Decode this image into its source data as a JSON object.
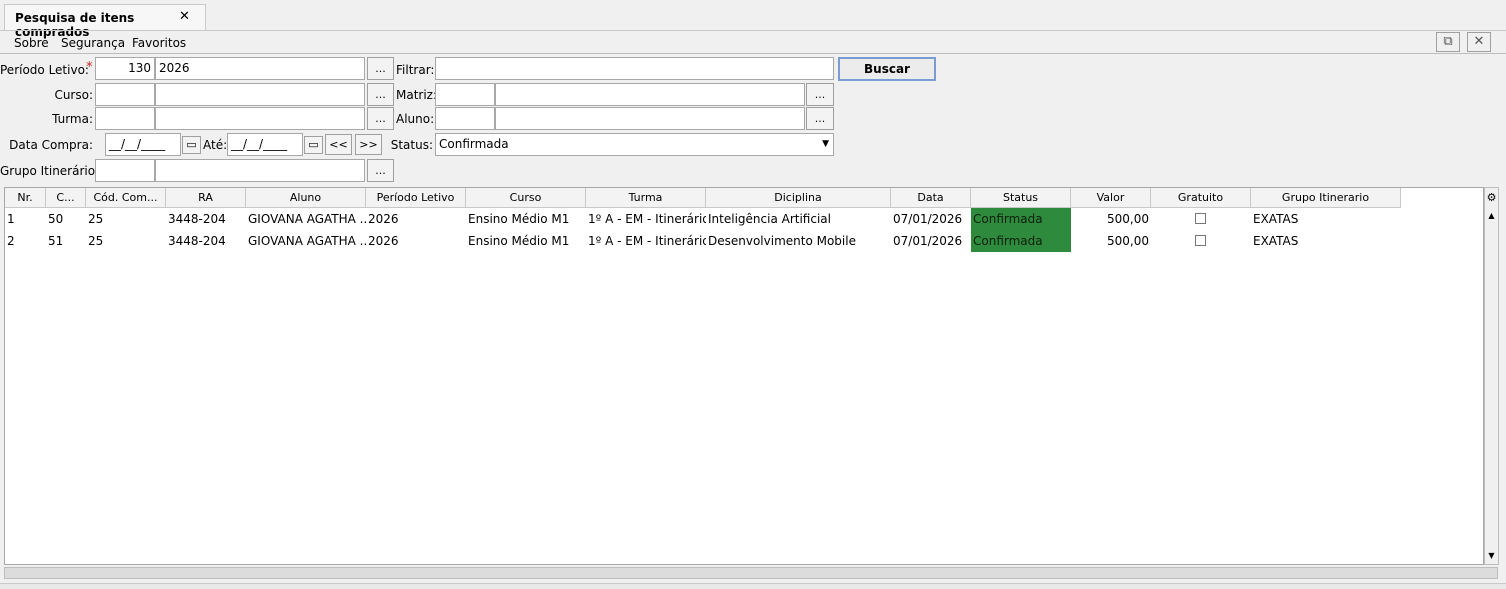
{
  "tab": {
    "title": "Pesquisa de itens comprados",
    "close": "✕"
  },
  "menu": {
    "sobre": "Sobre",
    "seguranca": "Segurança",
    "favoritos": "Favoritos"
  },
  "window_buttons": {
    "popout": "⧉",
    "close": "✕"
  },
  "form": {
    "periodo_label": "Período Letivo:",
    "periodo_code": "130",
    "periodo_desc": "2026",
    "filtrar_label": "Filtrar:",
    "filtrar_value": "",
    "buscar_label": "Buscar",
    "curso_label": "Curso:",
    "matriz_label": "Matriz:",
    "turma_label": "Turma:",
    "aluno_label": "Aluno:",
    "data_compra_label": "Data Compra:",
    "data_compra_value": "__/__/____",
    "ate_label": "Até:",
    "ate_value": "__/__/____",
    "prev_label": "<<",
    "next_label": ">>",
    "status_label": "Status:",
    "status_value": "Confirmada",
    "grupo_label": "Grupo Itinerário:",
    "ellipsis": "..."
  },
  "grid": {
    "columns": [
      "Nr.",
      "C...",
      "Cód. Com...",
      "RA",
      "Aluno",
      "Período Letivo",
      "Curso",
      "Turma",
      "Diciplina",
      "Data",
      "Status",
      "Valor",
      "Gratuito",
      "Grupo Itinerario"
    ],
    "rows": [
      {
        "nr": "1",
        "c": "50",
        "cod": "25",
        "ra": "3448-204",
        "aluno": "GIOVANA AGATHA ...",
        "periodo": "2026",
        "curso": "Ensino Médio M1",
        "turma": "1º A - EM - Itinerário",
        "disciplina": " Inteligência Artificial",
        "data": "07/01/2026",
        "status": "Confirmada",
        "valor": "500,00",
        "grupo": "EXATAS"
      },
      {
        "nr": "2",
        "c": "51",
        "cod": "25",
        "ra": "3448-204",
        "aluno": "GIOVANA AGATHA ...",
        "periodo": "2026",
        "curso": "Ensino Médio M1",
        "turma": "1º A - EM - Itinerário",
        "disciplina": "Desenvolvimento Mobile",
        "data": "07/01/2026",
        "status": "Confirmada",
        "valor": "500,00",
        "grupo": "EXATAS"
      }
    ],
    "status_color": "#2e8b3e"
  }
}
